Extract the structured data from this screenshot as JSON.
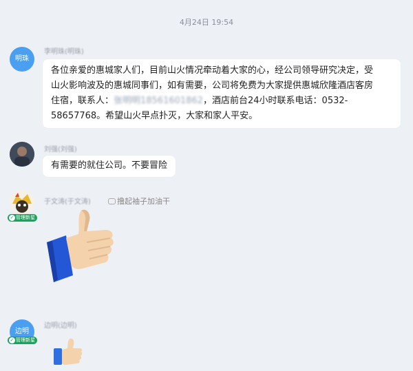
{
  "timestamp": "4月24日 19:54",
  "messages": [
    {
      "avatar_text": "明珠",
      "sender": "李明珠(明珠)",
      "line1": "各位亲爱的惠城家人们，目前山火情况牵动着大家的心，经公司领导研究决定，受",
      "line2": "山火影响波及的惠城同事们，如有需要，公司将免费为大家提供惠城欣隆酒店客房",
      "line3_prefix": "住宿，联系人：",
      "line3_masked": "张明明18561601862",
      "line3_suffix": "，酒店前台24小时联系电话：0532-",
      "line4": "58657768。希望山火早点扑灭，大家和家人平安。"
    },
    {
      "sender": "刘强(刘强)",
      "text": "有需要的就住公司。不要冒险"
    },
    {
      "sender": "于文涛(于文涛)",
      "badge": "管理新星",
      "status_text": "撸起袖子加油干",
      "sticker": "thumbs-up-sticker"
    },
    {
      "avatar_text": "边明",
      "sender": "边明(边明)",
      "badge": "管理新星",
      "sticker": "thumbs-up-emoji"
    }
  ],
  "colors": {
    "background": "#edf0f5",
    "bubble": "#ffffff",
    "avatar_blue": "#4a9ff0",
    "badge_green": "#17a45c",
    "thumb_skin": "#f3d2ac",
    "sleeve_blue": "#2457d6"
  }
}
